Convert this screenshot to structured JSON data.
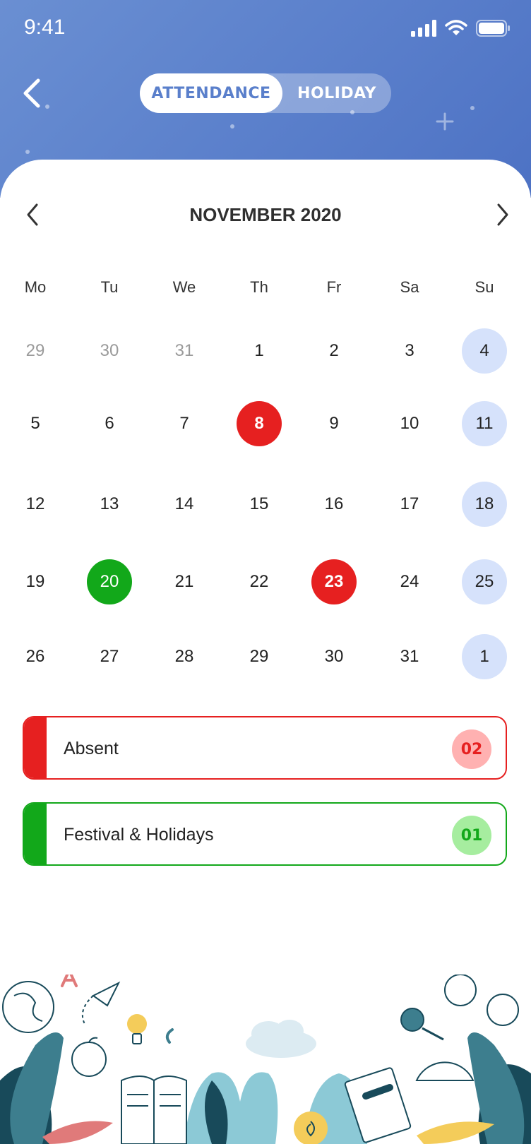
{
  "status_bar": {
    "time": "9:41"
  },
  "toggle": {
    "active_label": "ATTENDANCE",
    "inactive_label": "HOLIDAY"
  },
  "calendar": {
    "title": "NOVEMBER 2020",
    "weekdays": [
      "Mo",
      "Tu",
      "We",
      "Th",
      "Fr",
      "Sa",
      "Su"
    ],
    "weeks": [
      [
        "29",
        "30",
        "31",
        "1",
        "2",
        "3",
        "4"
      ],
      [
        "5",
        "6",
        "7",
        "8",
        "9",
        "10",
        "11"
      ],
      [
        "12",
        "13",
        "14",
        "15",
        "16",
        "17",
        "18"
      ],
      [
        "19",
        "20",
        "21",
        "22",
        "23",
        "24",
        "25"
      ],
      [
        "26",
        "27",
        "28",
        "29",
        "30",
        "31",
        "1"
      ]
    ],
    "absent_days": [
      "8",
      "23"
    ],
    "holiday_days": [
      "20"
    ]
  },
  "legend": [
    {
      "label": "Absent",
      "count": "02"
    },
    {
      "label": "Festival  & Holidays",
      "count": "01"
    }
  ],
  "colors": {
    "header": "#5a7fcb",
    "absent": "#e62020",
    "absent_badge_bg": "#ffb1b1",
    "holiday": "#12a81a",
    "holiday_badge_bg": "#a6ed9f",
    "sunday": "#d6e2fb"
  }
}
